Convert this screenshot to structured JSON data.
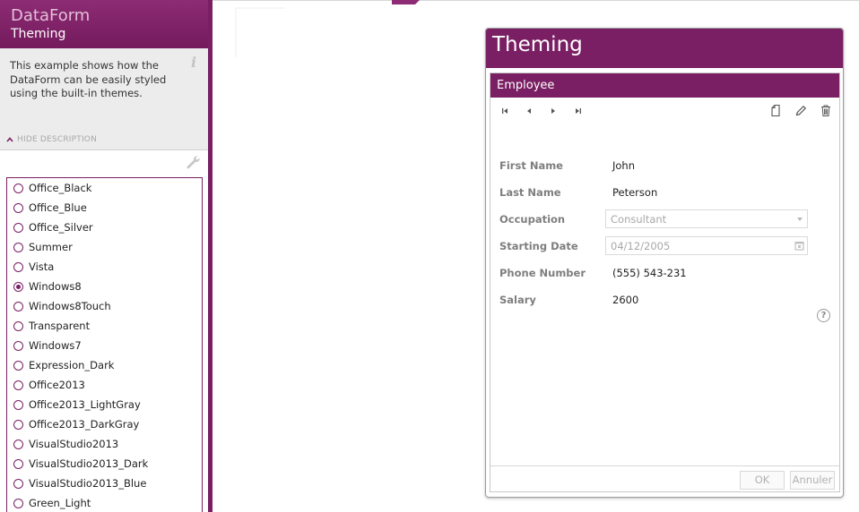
{
  "sidebar": {
    "title": "DataForm",
    "subtitle": "Theming",
    "description": "This example shows how the DataForm can be easily styled using the built-in themes.",
    "hide_description_label": "HIDE DESCRIPTION",
    "themes": [
      {
        "label": "Office_Black",
        "checked": false
      },
      {
        "label": "Office_Blue",
        "checked": false
      },
      {
        "label": "Office_Silver",
        "checked": false
      },
      {
        "label": "Summer",
        "checked": false
      },
      {
        "label": "Vista",
        "checked": false
      },
      {
        "label": "Windows8",
        "checked": true
      },
      {
        "label": "Windows8Touch",
        "checked": false
      },
      {
        "label": "Transparent",
        "checked": false
      },
      {
        "label": "Windows7",
        "checked": false
      },
      {
        "label": "Expression_Dark",
        "checked": false
      },
      {
        "label": "Office2013",
        "checked": false
      },
      {
        "label": "Office2013_LightGray",
        "checked": false
      },
      {
        "label": "Office2013_DarkGray",
        "checked": false
      },
      {
        "label": "VisualStudio2013",
        "checked": false
      },
      {
        "label": "VisualStudio2013_Dark",
        "checked": false
      },
      {
        "label": "VisualStudio2013_Blue",
        "checked": false
      },
      {
        "label": "Green_Light",
        "checked": false
      }
    ]
  },
  "panel": {
    "title": "Theming"
  },
  "dataform": {
    "header": "Employee",
    "fields": {
      "first_name": {
        "label": "First Name",
        "value": "John"
      },
      "last_name": {
        "label": "Last Name",
        "value": "Peterson"
      },
      "occupation": {
        "label": "Occupation",
        "value": "Consultant"
      },
      "starting_date": {
        "label": "Starting Date",
        "value": "04/12/2005"
      },
      "phone_number": {
        "label": "Phone Number",
        "value": "(555) 543-231"
      },
      "salary": {
        "label": "Salary",
        "value": "2600"
      }
    },
    "help_glyph": "?",
    "ok_label": "OK",
    "cancel_label": "Annuler"
  },
  "colors": {
    "accent": "#7a1f63",
    "label_gray": "#7e7e7e",
    "disabled_text": "#a8a8a8"
  }
}
